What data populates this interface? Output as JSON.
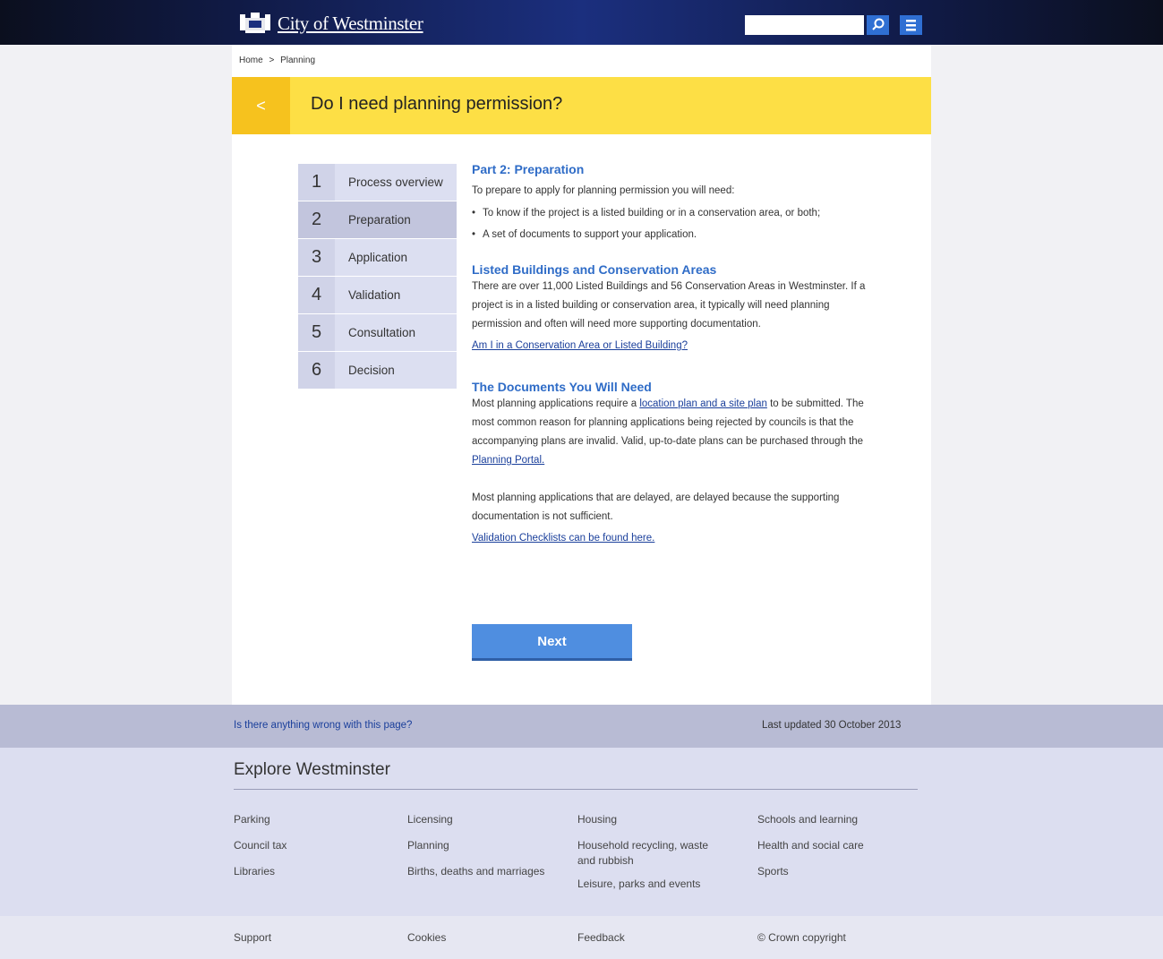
{
  "header": {
    "site_title": "City of Westminster",
    "search_placeholder": "",
    "search_icon": "search-icon",
    "menu_icon": "menu-icon"
  },
  "breadcrumb": [
    "Home",
    ">",
    "Planning"
  ],
  "banner": {
    "back_icon": "chevron-left-icon",
    "back_glyph": "<",
    "title": "Do I need planning permission?"
  },
  "steps": [
    {
      "num": "1",
      "label": "Process overview",
      "active": false
    },
    {
      "num": "2",
      "label": "Preparation",
      "active": true
    },
    {
      "num": "3",
      "label": "Application",
      "active": false
    },
    {
      "num": "4",
      "label": "Validation",
      "active": false
    },
    {
      "num": "5",
      "label": "Consultation",
      "active": false
    },
    {
      "num": "6",
      "label": "Decision",
      "active": false
    }
  ],
  "content": {
    "part_heading": "Part 2: Preparation",
    "intro": "To prepare to apply for planning permission you will need:",
    "bullets": [
      "To know if the project is a listed building or in a conservation area, or both;",
      "A set of documents to support your application."
    ],
    "listed_heading": "Listed Buildings and Conservation Areas",
    "listed_text": "There are over 11,000 Listed Buildings and 56 Conservation Areas in Westminster. If a project is in a listed building or conservation area, it typically will need planning permission and often will need more supporting documentation.",
    "listed_link": "Am I in a Conservation Area or Listed Building?",
    "docs_heading": "The Documents You Will Need",
    "docs_text_1": "Most planning applications require a",
    "docs_link_1": "location plan and a site plan",
    "docs_text_2": "to be submitted. The most common reason for planning applications being rejected by councils is that the accompanying plans are invalid. Valid, up-to-date plans can be purchased through the",
    "docs_link_2": "Planning Portal.",
    "delay_text": "Most planning applications that are delayed, are delayed because the supporting documentation is not sufficient.",
    "checklist_link": "Validation Checklists can be found here.",
    "next_label": "Next"
  },
  "footer": {
    "feedback_link": "Is there anything wrong with this page?",
    "last_updated": "Last updated  30 October 2013",
    "explore_title": "Explore Westminster",
    "columns": [
      [
        "Parking",
        "Council tax",
        "Libraries"
      ],
      [
        "Licensing",
        "Planning",
        "Births, deaths and marriages"
      ],
      [
        "Housing",
        "Household recycling, waste and rubbish",
        "Leisure, parks and events"
      ],
      [
        "Schools and learning",
        "Health and social care",
        "Sports"
      ]
    ],
    "bottom_links": [
      "Support",
      "Cookies",
      "Feedback",
      "© Crown copyright"
    ]
  },
  "colors": {
    "header": "#101a45",
    "accent_blue": "#2f6fd3",
    "banner_yellow": "#fddf45",
    "banner_back": "#f6c21e",
    "heading_blue": "#2f6cc7",
    "step_active": "#c2c5dd",
    "footer_bar": "#b8bbd4",
    "explore_bg": "#dcdef0"
  }
}
